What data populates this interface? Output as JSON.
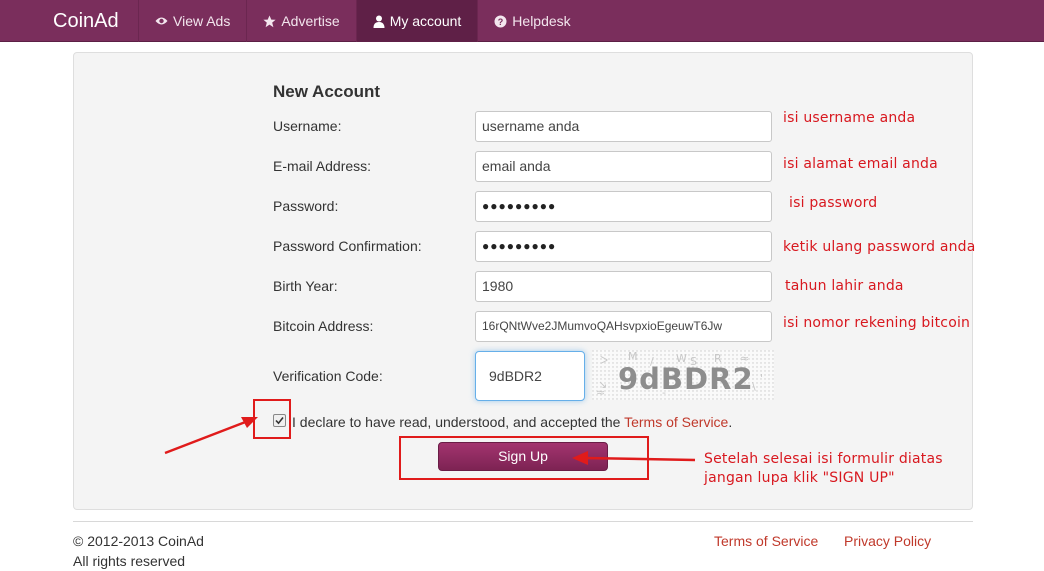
{
  "navbar": {
    "brand": "CoinAd",
    "items": [
      {
        "label": "View Ads",
        "icon": "eye-icon"
      },
      {
        "label": "Advertise",
        "icon": "star-icon"
      },
      {
        "label": "My account",
        "icon": "user-icon",
        "active": true
      },
      {
        "label": "Helpdesk",
        "icon": "question-circle-icon"
      }
    ]
  },
  "form": {
    "title": "New Account",
    "fields": [
      {
        "label": "Username:",
        "value": "username anda",
        "hint": "isi username anda"
      },
      {
        "label": "E-mail Address:",
        "value": "email anda",
        "hint": "isi alamat email anda"
      },
      {
        "label": "Password:",
        "value": "●●●●●●●●●",
        "hint": "isi password"
      },
      {
        "label": "Password Confirmation:",
        "value": "●●●●●●●●●",
        "hint": "ketik ulang password anda"
      },
      {
        "label": "Birth Year:",
        "value": "1980",
        "hint": "tahun lahir anda"
      },
      {
        "label": "Bitcoin Address:",
        "value": "16rQNtWve2JMumvoQAHsvpxioEgeuwT6Jw",
        "hint": "isi nomor rekening bitcoin"
      }
    ],
    "verification": {
      "label": "Verification Code:",
      "value": "9dBDR2",
      "captcha_text": "9dBDR2"
    },
    "declare": {
      "text": "I declare to have read, understood, and accepted the ",
      "link": "Terms of Service",
      "suffix": ".",
      "checked": true
    },
    "signup_label": "Sign Up",
    "signup_note_line1": "Setelah selesai isi formulir diatas",
    "signup_note_line2": "jangan lupa klik \"SIGN UP\""
  },
  "footer": {
    "copyright": "© 2012-2013 CoinAd",
    "rights": "All rights reserved",
    "links": [
      "Terms of Service",
      "Privacy Policy"
    ]
  },
  "colors": {
    "navbar": "#7a2e5c",
    "annotation": "#e01b1b",
    "link": "#c0392b"
  }
}
